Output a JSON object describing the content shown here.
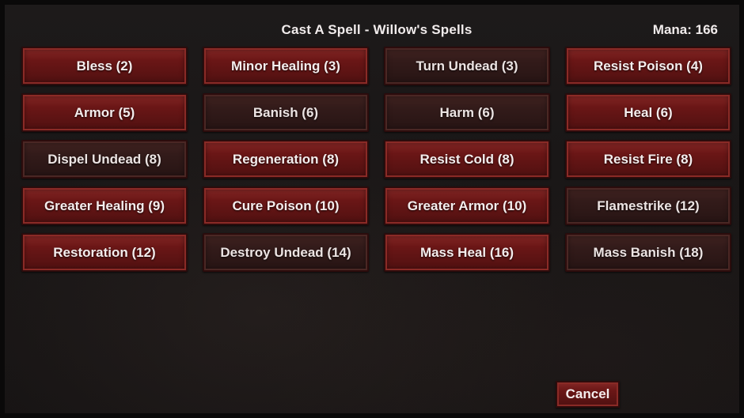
{
  "header": {
    "title": "Cast A Spell - Willow's Spells",
    "mana": "Mana: 166"
  },
  "spells": [
    {
      "label": "Bless (2)",
      "state": "bright"
    },
    {
      "label": "Minor Healing (3)",
      "state": "bright"
    },
    {
      "label": "Turn Undead (3)",
      "state": "dim"
    },
    {
      "label": "Resist Poison (4)",
      "state": "bright"
    },
    {
      "label": "Armor (5)",
      "state": "bright"
    },
    {
      "label": "Banish (6)",
      "state": "dim"
    },
    {
      "label": "Harm (6)",
      "state": "dim"
    },
    {
      "label": "Heal (6)",
      "state": "bright"
    },
    {
      "label": "Dispel Undead (8)",
      "state": "dim"
    },
    {
      "label": "Regeneration (8)",
      "state": "bright"
    },
    {
      "label": "Resist Cold (8)",
      "state": "bright"
    },
    {
      "label": "Resist Fire (8)",
      "state": "bright"
    },
    {
      "label": "Greater Healing (9)",
      "state": "bright"
    },
    {
      "label": "Cure Poison (10)",
      "state": "bright"
    },
    {
      "label": "Greater Armor (10)",
      "state": "bright"
    },
    {
      "label": "Flamestrike (12)",
      "state": "dim"
    },
    {
      "label": "Restoration (12)",
      "state": "bright"
    },
    {
      "label": "Destroy Undead (14)",
      "state": "dim"
    },
    {
      "label": "Mass Heal (16)",
      "state": "bright"
    },
    {
      "label": "Mass Banish (18)",
      "state": "dim"
    }
  ],
  "footer": {
    "cancel_label": "Cancel"
  }
}
